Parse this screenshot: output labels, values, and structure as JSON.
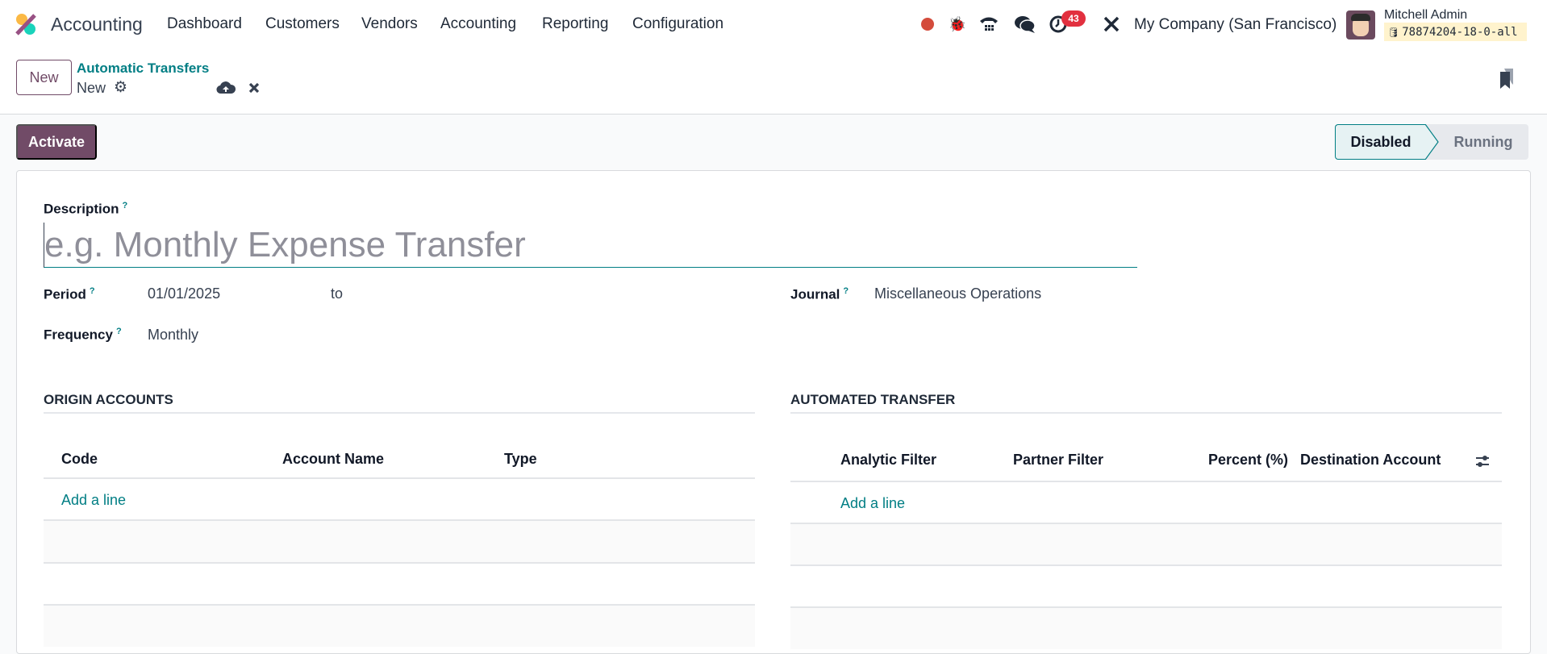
{
  "navbar": {
    "app_name": "Accounting",
    "menu": [
      "Dashboard",
      "Customers",
      "Vendors",
      "Accounting",
      "Reporting",
      "Configuration"
    ],
    "activity_count": "43",
    "company": "My Company (San Francisco)",
    "user_name": "Mitchell Admin",
    "database": "78874204-18-0-all"
  },
  "control_panel": {
    "new_label": "New",
    "breadcrumb": "Automatic Transfers",
    "record": "New"
  },
  "actions": {
    "activate": "Activate"
  },
  "statusbar": {
    "stages": [
      "Disabled",
      "Running"
    ],
    "current": "Disabled"
  },
  "form": {
    "description_label": "Description",
    "description_placeholder": "e.g. Monthly Expense Transfer",
    "period_label": "Period",
    "period_start": "01/01/2025",
    "period_to": "to",
    "frequency_label": "Frequency",
    "frequency": "Monthly",
    "journal_label": "Journal",
    "journal": "Miscellaneous Operations",
    "help": "?"
  },
  "origin": {
    "title": "ORIGIN ACCOUNTS",
    "columns": [
      "Code",
      "Account Name",
      "Type"
    ],
    "add_line": "Add a line"
  },
  "automated": {
    "title": "AUTOMATED TRANSFER",
    "columns": [
      "Analytic Filter",
      "Partner Filter",
      "Percent (%)",
      "Destination Account"
    ],
    "add_line": "Add a line"
  },
  "colors": {
    "primary": "#714B67",
    "accent": "#017E84",
    "badge": "#E2303F"
  }
}
